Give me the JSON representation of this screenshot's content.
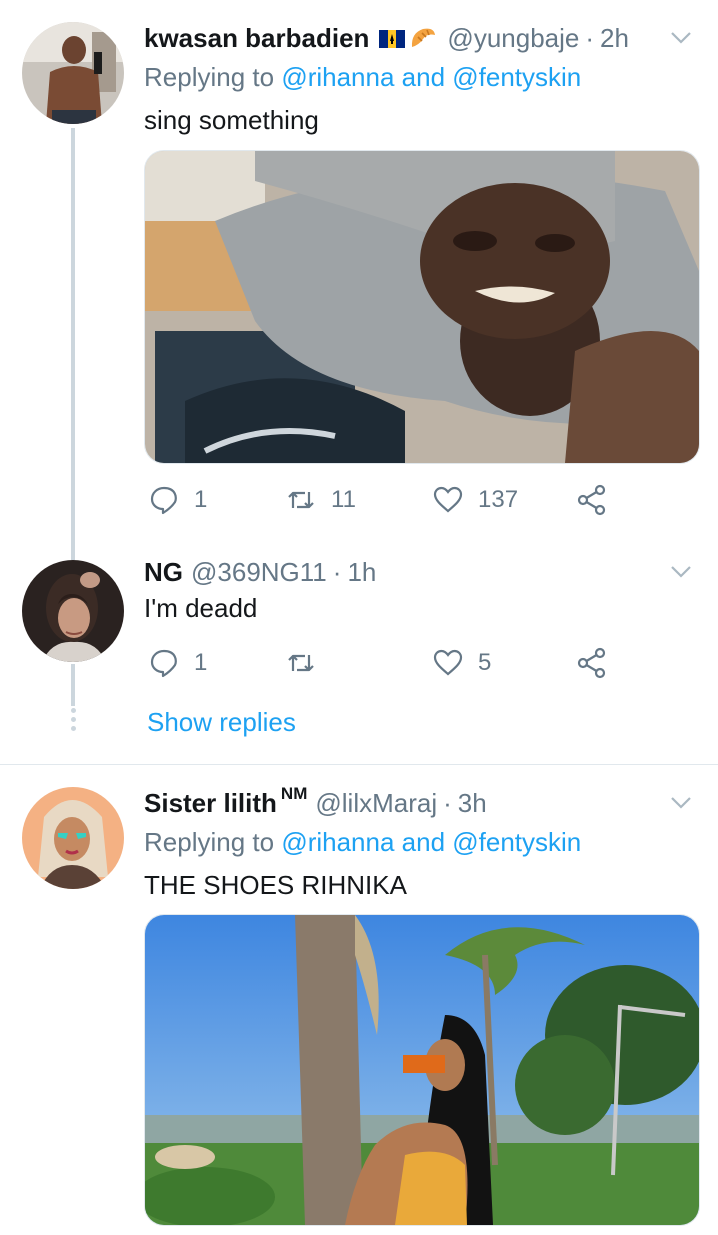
{
  "tweets": [
    {
      "name": "kwasan barbadien",
      "handle": "@yungbaje",
      "time": "2h",
      "replying_prefix": "Replying to ",
      "replying_users": "@rihanna and @fentyskin",
      "text": "sing something",
      "reply_count": "1",
      "retweet_count": "11",
      "like_count": "137",
      "emoji": [
        "barbados-flag-icon",
        "croissant-icon"
      ]
    },
    {
      "name": "NG",
      "handle": "@369NG11",
      "time": "1h",
      "text": "I'm deadd",
      "reply_count": "1",
      "retweet_count": "",
      "like_count": "5",
      "show_replies": "Show replies"
    },
    {
      "name": "Sister lilith",
      "name_suffix": "NM",
      "handle": "@lilxMaraj",
      "time": "3h",
      "replying_prefix": "Replying to ",
      "replying_users": "@rihanna and @fentyskin",
      "text": "THE SHOES RIHNIKA"
    }
  ],
  "separator": "·",
  "colors": {
    "link": "#1da1f2",
    "muted": "#657786",
    "text": "#14171a",
    "thread_line": "#ccd6dd"
  }
}
